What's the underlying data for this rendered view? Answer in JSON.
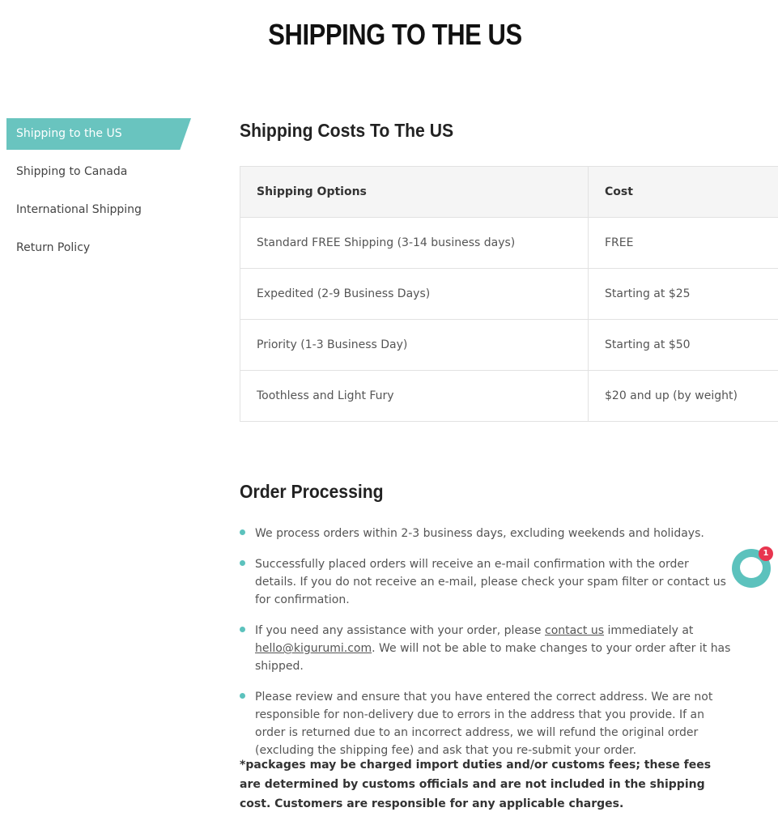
{
  "page": {
    "title": "SHIPPING TO THE US"
  },
  "sidebar": {
    "items": [
      {
        "label": "Shipping to the US",
        "active": true
      },
      {
        "label": "Shipping to Canada"
      },
      {
        "label": "International Shipping"
      },
      {
        "label": "Return Policy"
      }
    ]
  },
  "costs": {
    "heading": "Shipping Costs To The US",
    "columns": [
      "Shipping Options",
      "Cost"
    ],
    "rows": [
      [
        "Standard FREE Shipping (3-14 business days)",
        "FREE"
      ],
      [
        "Expedited (2-9 Business Days)",
        "Starting at $25"
      ],
      [
        "Priority (1-3 Business Day)",
        "Starting at $50"
      ],
      [
        "Toothless and Light Fury",
        "$20 and up (by weight)"
      ]
    ]
  },
  "order": {
    "heading": "Order Processing",
    "b1": "We process orders within 2-3 business days, excluding weekends and holidays.",
    "b2": "Successfully placed orders will receive an e-mail confirmation with the order details. If you do not receive an e-mail, please check your spam filter or contact us for confirmation.",
    "b3_pre": "If you need any assistance with your order, please ",
    "b3_link": "contact us",
    "b3_mid": " immediately at ",
    "b3_email": "hello@kigurumi.com",
    "b3_post": ". We will not be able to make changes to your order after it has shipped.",
    "b4": "Please review and ensure that you have entered the correct address. We are not responsible for non-delivery due to errors in the address that you provide. If an order is returned due to an incorrect address, we will refund the original order (excluding the shipping fee) and ask that you re-submit your order.",
    "note": "*packages may be charged import duties and/or customs fees; these fees are determined by customs officials and are not included in the shipping cost. Customers are responsible for any applicable charges."
  },
  "chat": {
    "badge": "1",
    "accent": "#5cc2bd",
    "badge_color": "#e8354f",
    "icon": "chat-bubble-icon"
  },
  "colors": {
    "accent": "#69c4bf"
  }
}
